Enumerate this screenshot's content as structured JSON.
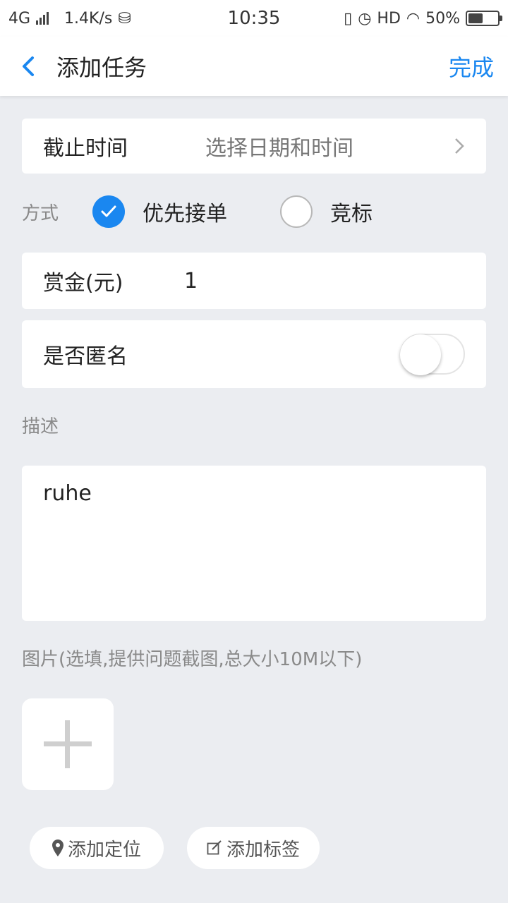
{
  "status_bar": {
    "network": "4G",
    "speed": "1.4K/s",
    "time": "10:35",
    "hd": "HD",
    "battery": "50%",
    "battery_level": 0.5
  },
  "header": {
    "title": "添加任务",
    "done_label": "完成"
  },
  "form": {
    "deadline": {
      "label": "截止时间",
      "placeholder": "选择日期和时间"
    },
    "mode": {
      "label": "方式",
      "options": [
        {
          "label": "优先接单",
          "selected": true
        },
        {
          "label": "竞标",
          "selected": false
        }
      ]
    },
    "reward": {
      "label": "赏金(元)",
      "value": "1"
    },
    "anonymous": {
      "label": "是否匿名",
      "on": false
    },
    "description": {
      "label": "描述",
      "value": "ruhe"
    },
    "images": {
      "label": "图片(选填,提供问题截图,总大小10M以下)"
    }
  },
  "actions": {
    "add_location": "添加定位",
    "add_tag": "添加标签"
  },
  "colors": {
    "accent": "#1a87f0",
    "background": "#ebedf1"
  }
}
